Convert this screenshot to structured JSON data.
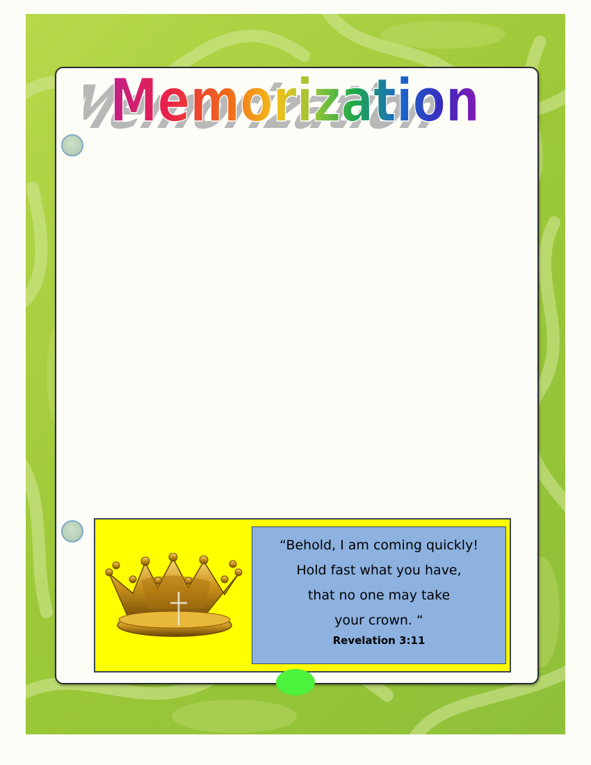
{
  "title": "Memorization",
  "verse": {
    "lines": [
      "“Behold, I am coming quickly!",
      "Hold fast what you have,",
      "that no one may take",
      "your crown. “"
    ],
    "reference": "Revelation 3:11"
  },
  "colors": {
    "background_green": "#9cc838",
    "banner_yellow": "#ffff00",
    "verse_box_blue": "#8db2e0",
    "accent_dot": "#4cf23c"
  },
  "icons": [
    "crown-icon"
  ]
}
